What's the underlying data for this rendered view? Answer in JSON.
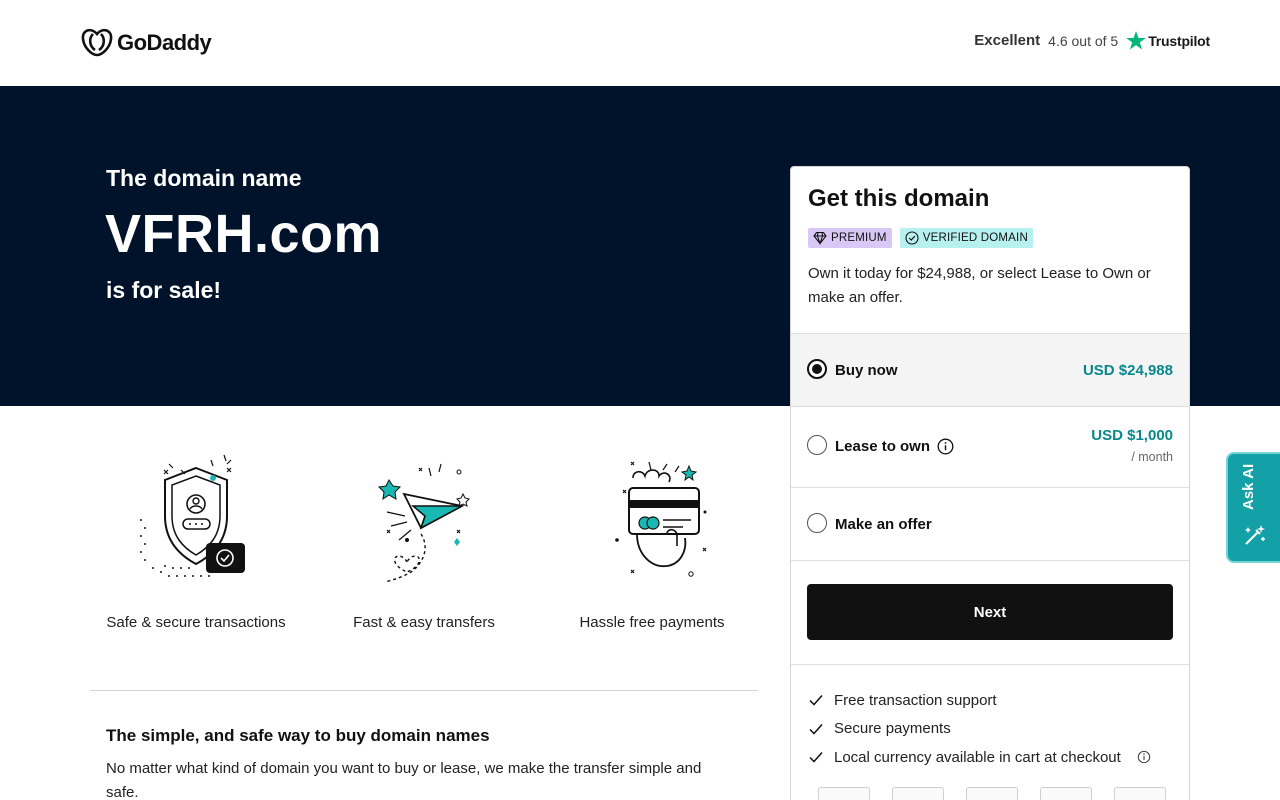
{
  "header": {
    "logo_text": "GoDaddy",
    "trustpilot": {
      "rating_word": "Excellent",
      "score_text": "4.6 out of 5",
      "brand": "Trustpilot"
    }
  },
  "hero": {
    "pre_text": "The domain name",
    "domain": "VFRH.com",
    "post_text": "is for sale!"
  },
  "features": [
    {
      "label": "Safe & secure transactions",
      "icon": "shield-icon"
    },
    {
      "label": "Fast & easy transfers",
      "icon": "paper-plane-icon"
    },
    {
      "label": "Hassle free payments",
      "icon": "card-hand-icon"
    }
  ],
  "info": {
    "title": "The simple, and safe way to buy domain names",
    "text": "No matter what kind of domain you want to buy or lease, we make the transfer simple and safe."
  },
  "card": {
    "title": "Get this domain",
    "badge_premium": "PREMIUM",
    "badge_verified": "VERIFIED DOMAIN",
    "description": "Own it today for $24,988, or select Lease to Own or make an offer.",
    "options": {
      "buy": {
        "label": "Buy now",
        "price": "USD $24,988",
        "selected": true
      },
      "lease": {
        "label": "Lease to own",
        "price": "USD $1,000",
        "sub": "/ month",
        "selected": false
      },
      "offer": {
        "label": "Make an offer",
        "selected": false
      }
    },
    "next_label": "Next",
    "benefits": [
      "Free transaction support",
      "Secure payments",
      "Local currency available in cart at checkout"
    ]
  },
  "ask_ai": {
    "label": "Ask AI"
  },
  "colors": {
    "hero_bg": "#00132b",
    "accent_teal": "#09888c",
    "ask_ai_bg": "#13a1a7",
    "trustpilot_green": "#00b67a"
  }
}
